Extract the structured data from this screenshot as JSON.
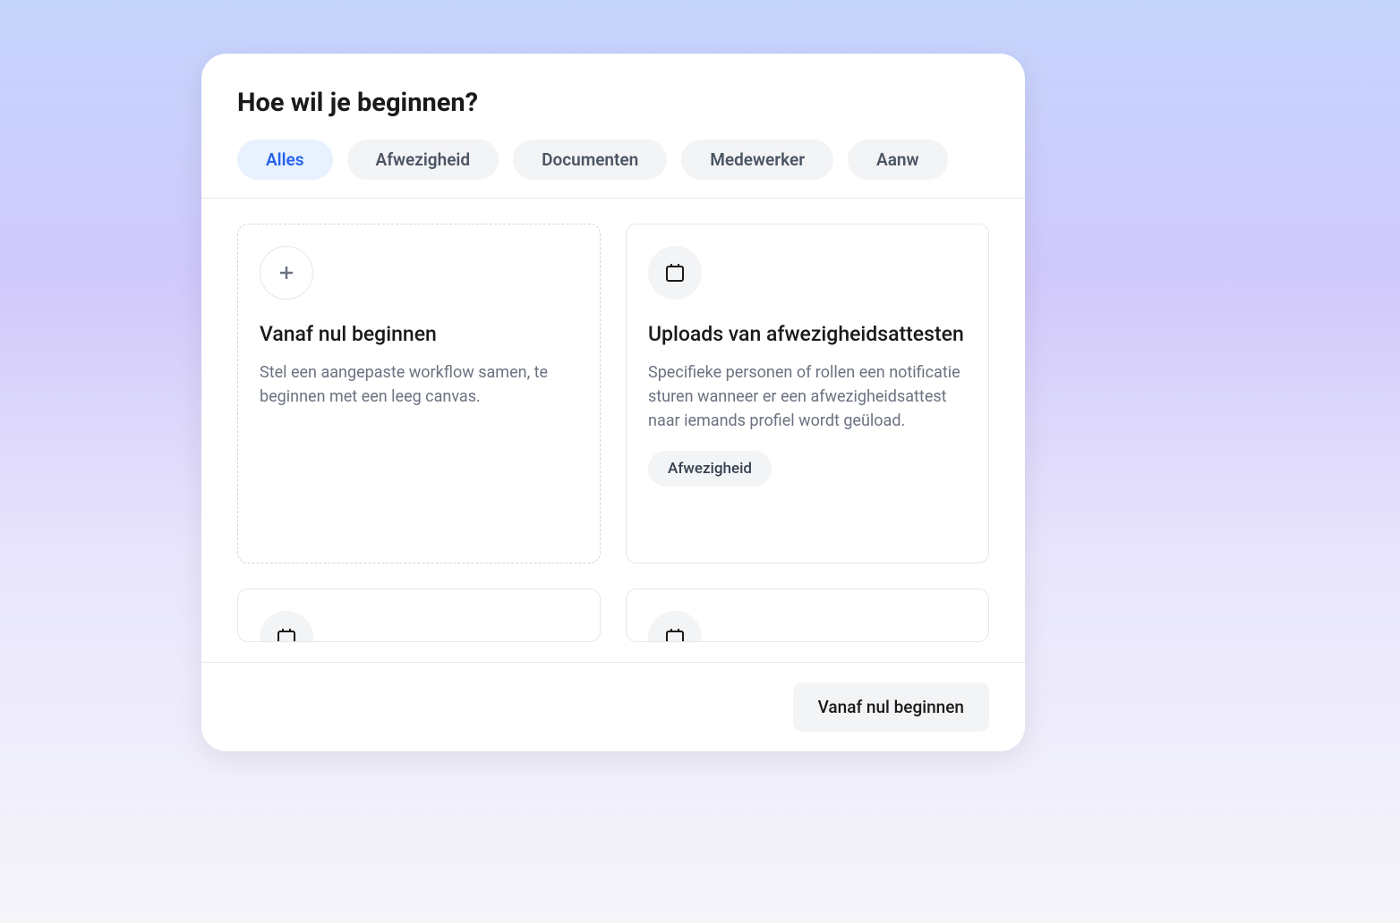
{
  "modal": {
    "title": "Hoe wil je beginnen?"
  },
  "tabs": [
    {
      "label": "Alles",
      "active": true
    },
    {
      "label": "Afwezigheid",
      "active": false
    },
    {
      "label": "Documenten",
      "active": false
    },
    {
      "label": "Medewerker",
      "active": false
    },
    {
      "label": "Aanw",
      "active": false
    }
  ],
  "cards": [
    {
      "title": "Vanaf nul beginnen",
      "description": "Stel een aangepaste workflow samen, te beginnen met een leeg canvas.",
      "icon": "plus",
      "style": "dashed",
      "tag": null
    },
    {
      "title": "Uploads van afwezigheidsattesten",
      "description": "Specifieke personen of rollen een notificatie sturen wanneer er een afwezigheidsattest naar iemands profiel wordt geüload.",
      "icon": "calendar",
      "style": "solid",
      "tag": "Afwezigheid"
    }
  ],
  "footer": {
    "button_label": "Vanaf nul beginnen"
  }
}
